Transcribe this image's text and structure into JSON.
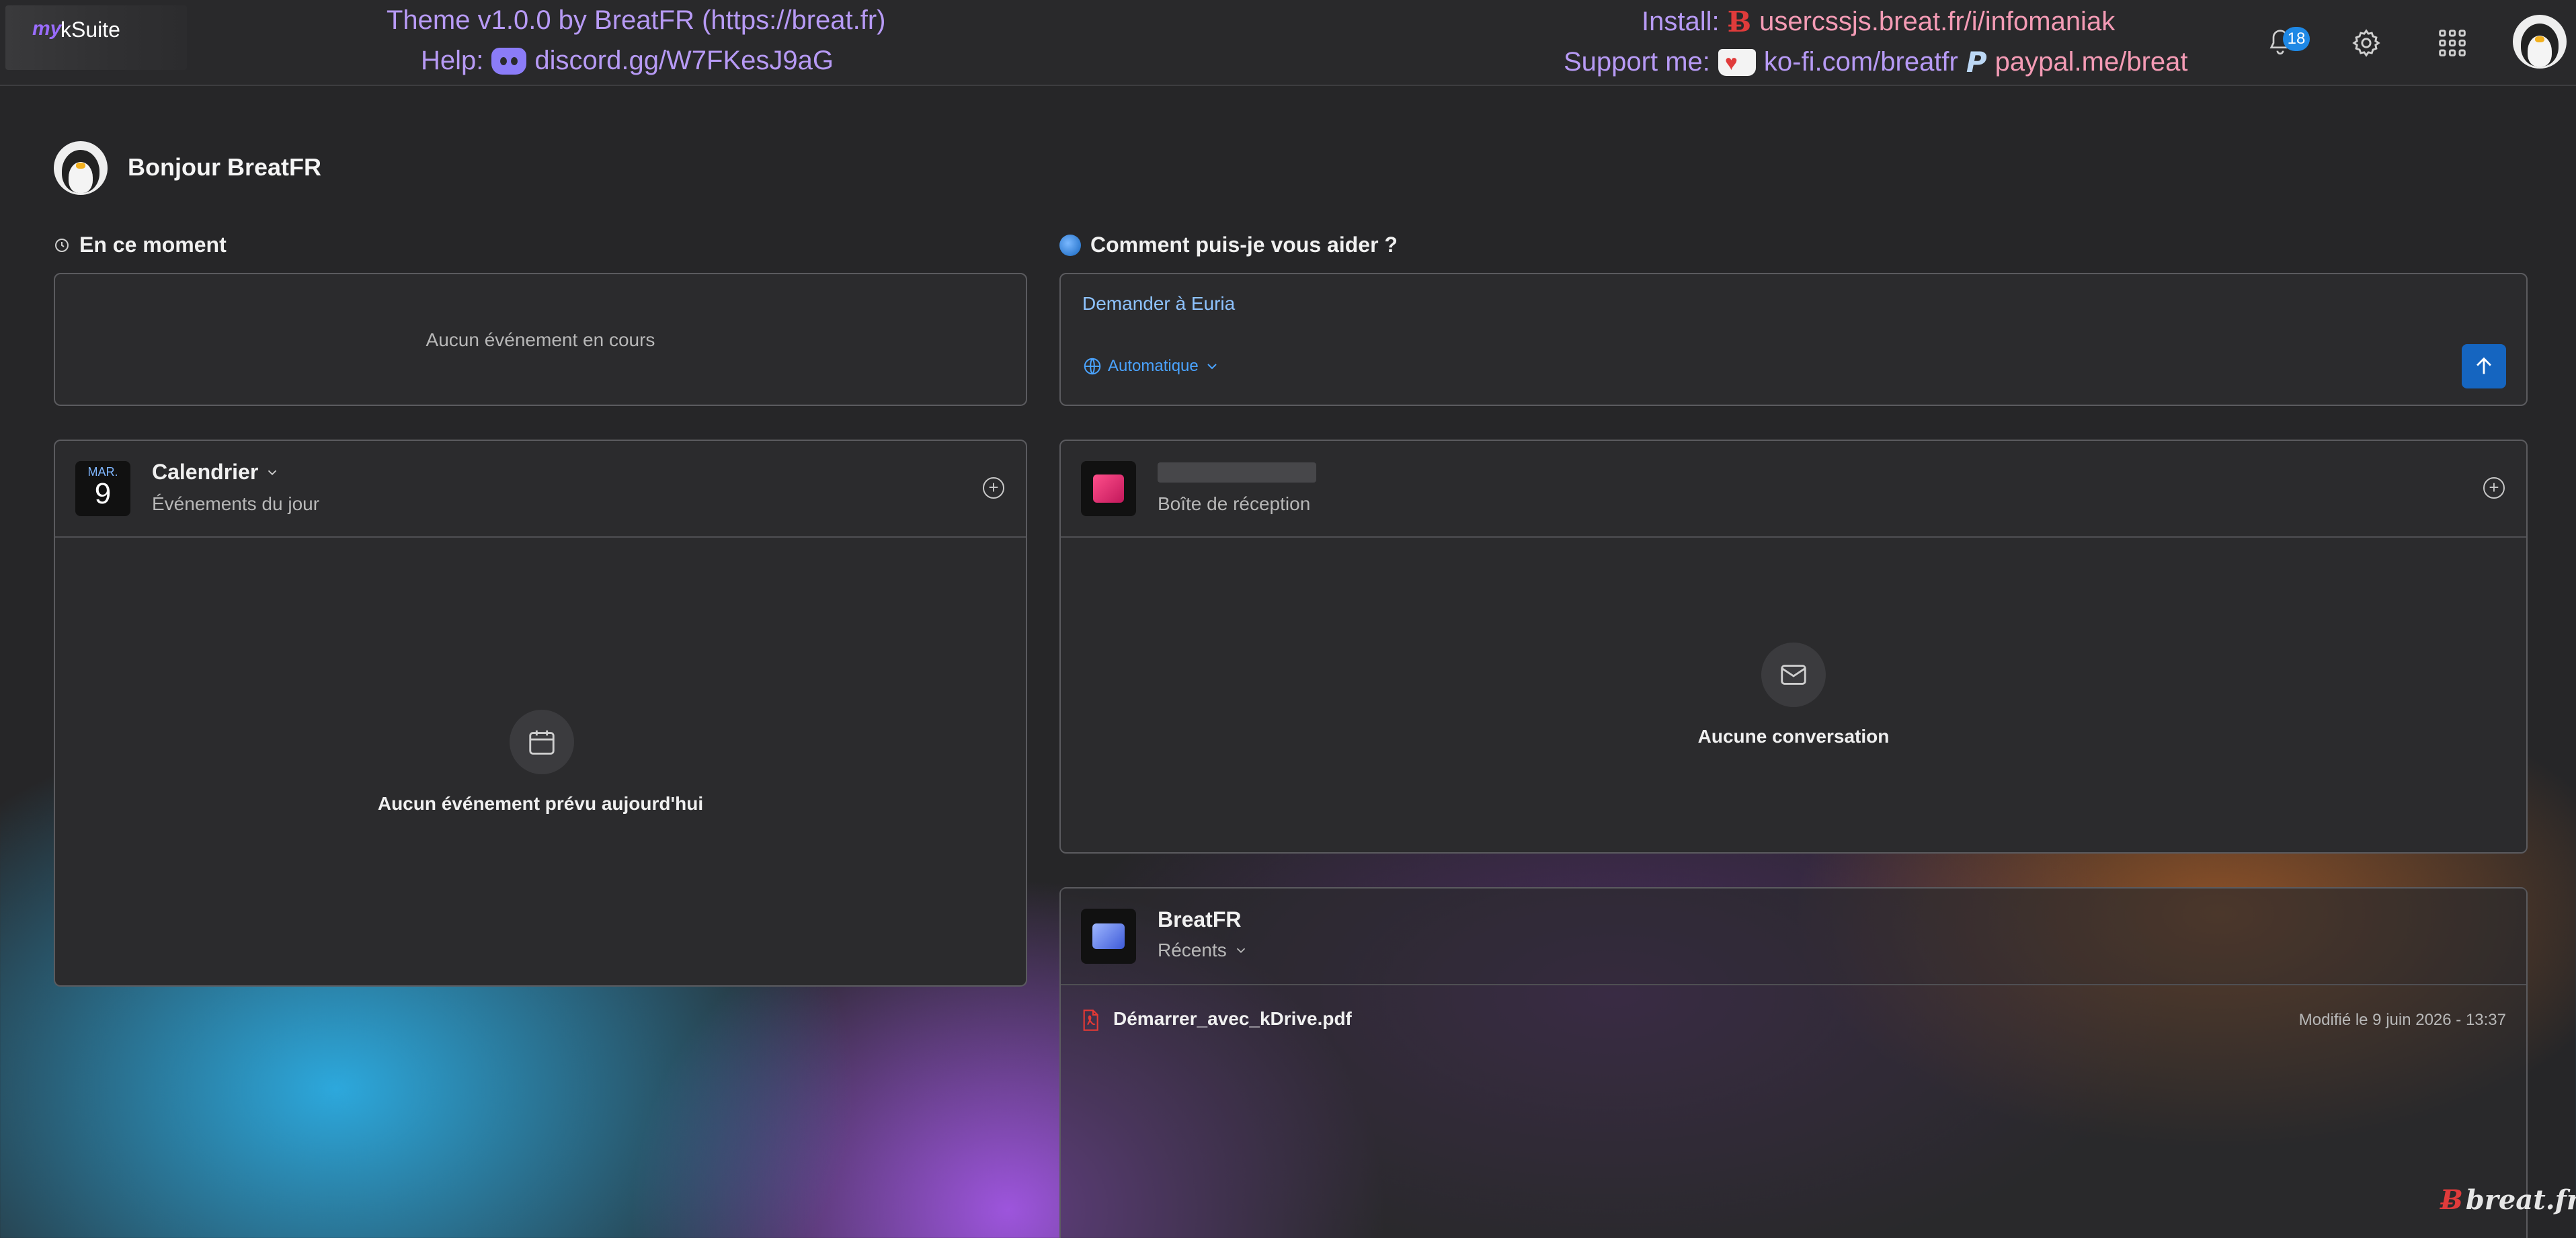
{
  "app": {
    "logo_my": "my",
    "logo_ksuite": "kSuite"
  },
  "promo": {
    "theme_line": "Theme v1.0.0 by BreatFR (https://breat.fr)",
    "help_label": "Help:",
    "help_link": "discord.gg/W7FKesJ9aG",
    "install_label": "Install:",
    "install_link": "usercssjs.breat.fr/i/infomaniak",
    "support_label": "Support me:",
    "kofi_link": "ko-fi.com/breatfr",
    "paypal_link": "paypal.me/breat"
  },
  "topbar": {
    "notifications_count": "18",
    "icons": [
      "bell-icon",
      "gear-icon",
      "apps-grid-icon",
      "avatar"
    ]
  },
  "greeting": "Bonjour BreatFR",
  "now": {
    "title": "En ce moment",
    "empty": "Aucun événement en cours"
  },
  "assistant": {
    "title": "Comment puis-je vous aider ?",
    "placeholder": "Demander à Euria",
    "mode": "Automatique"
  },
  "calendar": {
    "title": "Calendrier",
    "subtitle": "Événements du jour",
    "month": "MAR.",
    "day": "9",
    "empty": "Aucun événement prévu aujourd'hui"
  },
  "mail": {
    "subtitle": "Boîte de réception",
    "empty": "Aucune conversation"
  },
  "drive": {
    "title": "BreatFR",
    "filter": "Récents",
    "files": [
      {
        "name": "Démarrer_avec_kDrive.pdf",
        "modified": "Modifié le 9 juin 2026 - 13:37"
      }
    ]
  },
  "watermark": "breat.fr",
  "colors": {
    "accent": "#1e88e5",
    "promo_violet": "#a78bfa",
    "promo_pink": "#f49bb5",
    "link_blue": "#4aa3ff",
    "pdf_red": "#e53935"
  }
}
